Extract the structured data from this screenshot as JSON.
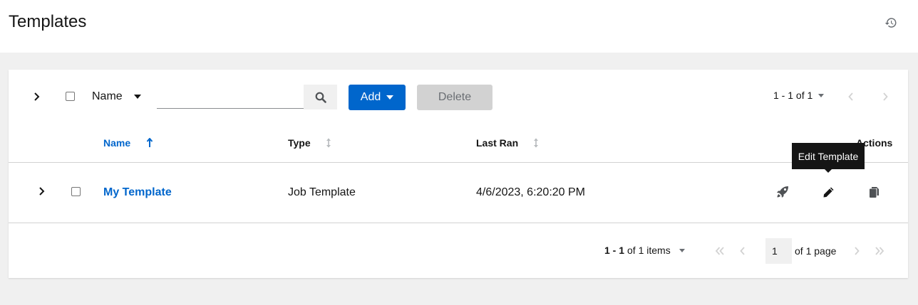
{
  "header": {
    "title": "Templates",
    "history_icon": "history-icon"
  },
  "toolbar": {
    "filter_field": "Name",
    "search_value": "",
    "search_placeholder": "",
    "add_label": "Add",
    "delete_label": "Delete",
    "pagination_summary": "1 - 1 of 1"
  },
  "table": {
    "columns": [
      {
        "label": "Name",
        "sorted": true,
        "direction": "asc"
      },
      {
        "label": "Type",
        "sorted": false
      },
      {
        "label": "Last Ran",
        "sorted": false
      },
      {
        "label": "Actions"
      }
    ],
    "rows": [
      {
        "name": "My Template",
        "type": "Job Template",
        "last_ran": "4/6/2023, 6:20:20 PM"
      }
    ],
    "actions": [
      "rocket-icon",
      "pencil-icon",
      "copy-icon"
    ]
  },
  "tooltip": {
    "text": "Edit Template"
  },
  "pagination": {
    "range": "1 - 1",
    "of_items": "of 1 items",
    "current_page": "1",
    "of_pages": "of 1 page"
  },
  "colors": {
    "primary": "#0066cc",
    "background": "#f0f0f0",
    "disabled": "#d2d2d2",
    "tooltip_bg": "#151515"
  }
}
